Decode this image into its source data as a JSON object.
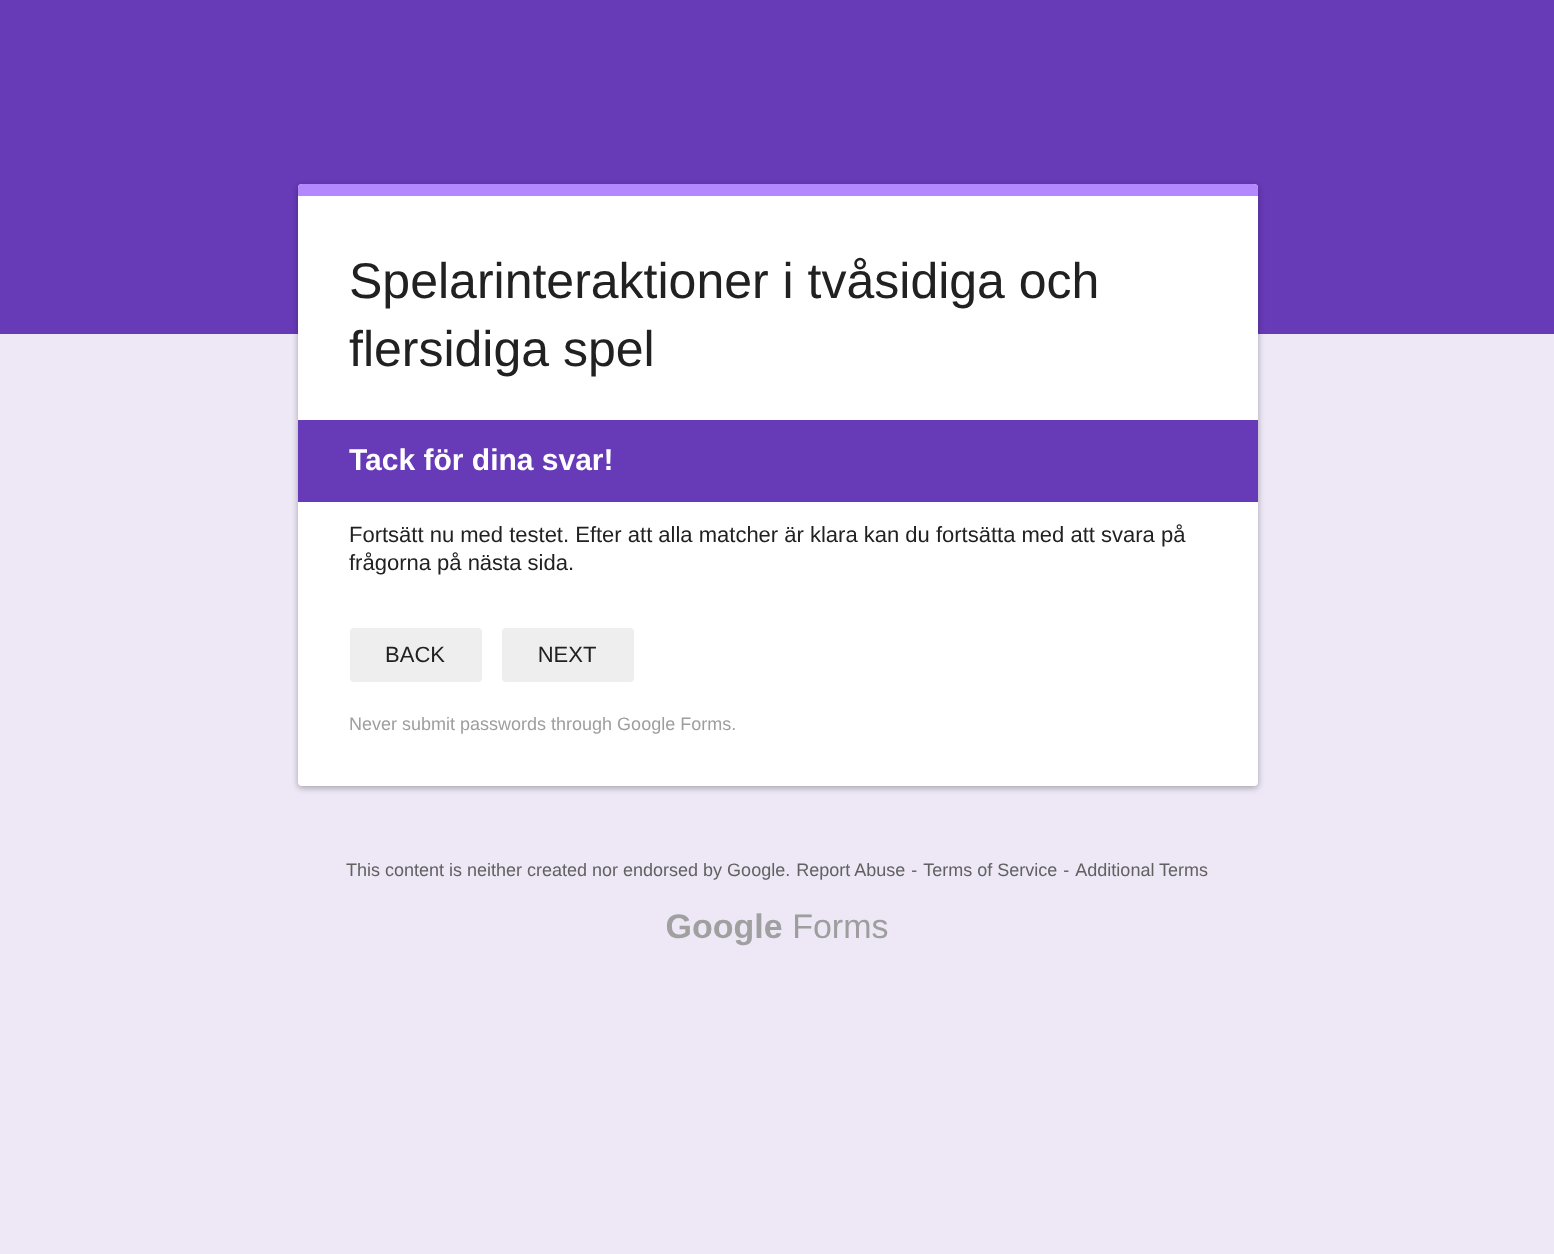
{
  "form": {
    "title": "Spelarinteraktioner i tvåsidiga och flersidiga spel",
    "section_title": "Tack för dina svar!",
    "description": "Fortsätt nu med testet. Efter att alla matcher är klara kan du fortsätta med att svara på frågorna på nästa sida.",
    "buttons": [
      "BACK",
      "NEXT"
    ],
    "warning": "Never submit passwords through Google Forms."
  },
  "footer": {
    "disclaimer": "This content is neither created nor endorsed by Google.",
    "links": [
      "Report Abuse",
      "Terms of Service",
      "Additional Terms"
    ],
    "separator": "-",
    "logo": {
      "brand": "Google",
      "product": "Forms"
    }
  }
}
